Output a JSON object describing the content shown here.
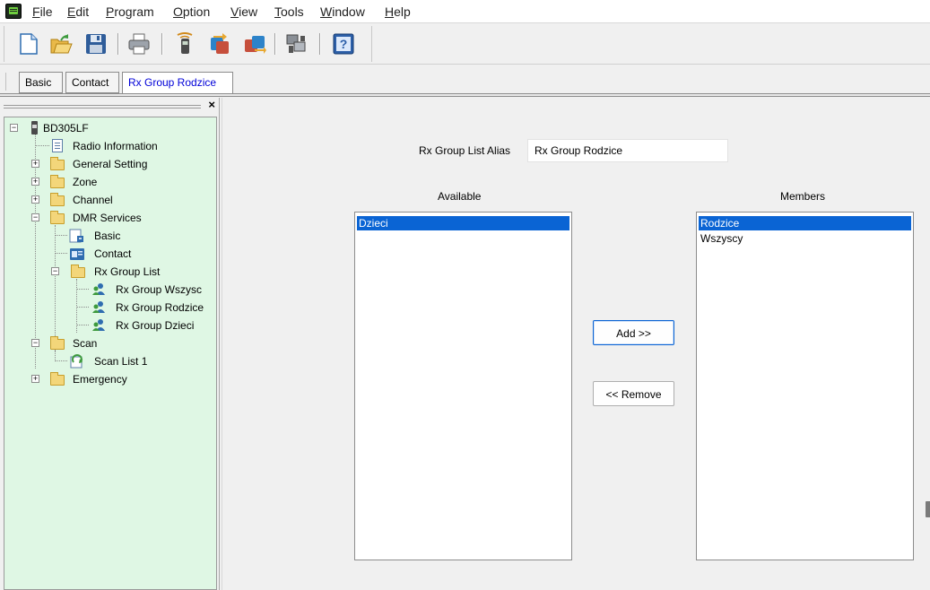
{
  "menu": {
    "items": [
      {
        "label": "File",
        "key": "F",
        "rest": "ile"
      },
      {
        "label": "Edit",
        "key": "E",
        "rest": "dit"
      },
      {
        "label": "Program",
        "key": "P",
        "rest": "rogram"
      },
      {
        "label": "Option",
        "key": "O",
        "rest": "ption"
      },
      {
        "label": "View",
        "key": "V",
        "rest": "iew"
      },
      {
        "label": "Tools",
        "key": "T",
        "rest": "ools"
      },
      {
        "label": "Window",
        "key": "W",
        "rest": "indow"
      },
      {
        "label": "Help",
        "key": "H",
        "rest": "elp"
      }
    ]
  },
  "toolbar": {
    "buttons": [
      "new-file-icon",
      "open-folder-icon",
      "save-icon",
      "print-icon",
      "read-radio-icon",
      "write-radio-icon",
      "copy-radio-icon",
      "program-icon",
      "help-icon"
    ]
  },
  "tabs": [
    {
      "label": "Basic",
      "active": false
    },
    {
      "label": "Contact",
      "active": false
    },
    {
      "label": "Rx Group Rodzice",
      "active": true
    }
  ],
  "tree": {
    "close_glyph": "×",
    "root": "BD305LF",
    "radio_information": "Radio Information",
    "general_setting": "General Setting",
    "zone": "Zone",
    "channel": "Channel",
    "dmr_services": "DMR Services",
    "basic": "Basic",
    "contact": "Contact",
    "rx_group_list": "Rx Group List",
    "rx_group_1": "Rx Group Wszysc",
    "rx_group_2": "Rx Group Rodzice",
    "rx_group_3": "Rx Group Dzieci",
    "scan": "Scan",
    "scan_list_1": "Scan List 1",
    "emergency": "Emergency"
  },
  "form": {
    "alias_label": "Rx Group List Alias",
    "alias_value": "Rx Group Rodzice",
    "available_label": "Available",
    "members_label": "Members",
    "available_items": [
      "Dzieci"
    ],
    "members_items": [
      "Rodzice",
      "Wszyscy"
    ],
    "add_label": "Add >>",
    "remove_label": "<< Remove"
  },
  "colors": {
    "tree_background": "#dff7e4",
    "selection": "#0a64d4",
    "active_tab_text": "#0000d8"
  }
}
